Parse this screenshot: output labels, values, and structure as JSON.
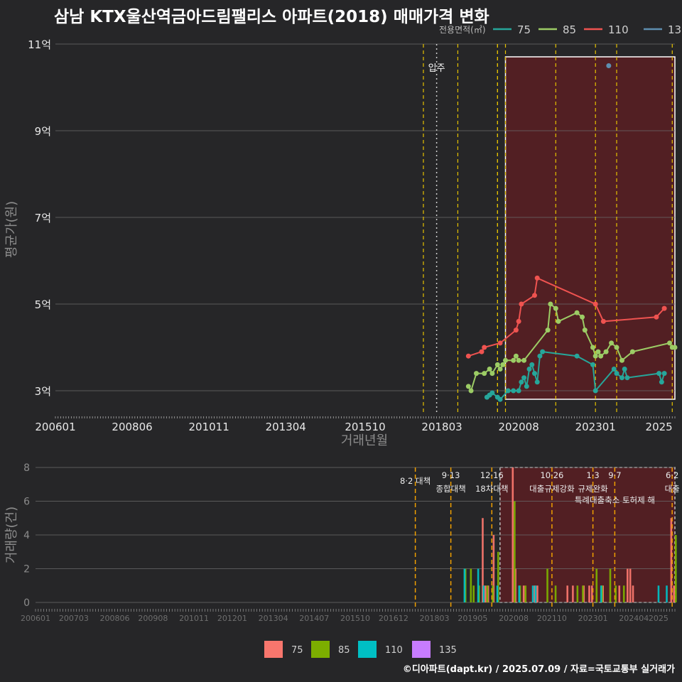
{
  "title": "삼남 KTX울산역금아드림팰리스 아파트(2018) 매매가격 변화",
  "credit": "©디아파트(dapt.kr) / 2025.07.09 / 자료=국토교통부 실거래가",
  "colors": {
    "75": "#f8766d",
    "85": "#7cae00",
    "110": "#00bfc4",
    "135": "#c77cff",
    "line75": "#26a69a",
    "line85": "#9ccc65",
    "line110": "#ef5350",
    "line135": "#5e8fb0",
    "policy": "#e6c200",
    "highlight": "#5a1e22"
  },
  "chart_data": [
    {
      "type": "line",
      "title": "삼남 KTX울산역금아드림팰리스 아파트(2018) 매매가격 변화",
      "xlabel": "거래년월",
      "ylabel": "평균가(원)",
      "x_ticks": [
        "200601",
        "200806",
        "201011",
        "201304",
        "201510",
        "201803",
        "202008",
        "202301",
        "2025"
      ],
      "y_ticks": [
        "3억",
        "5억",
        "7억",
        "9억",
        "11억"
      ],
      "ylim": [
        2.4,
        11.2
      ],
      "y_unit": "억",
      "legend_title": "전용면적(㎡)",
      "legend_position": "top-right",
      "move_in_label": "입주",
      "move_in_date": "2018-01",
      "highlight_range": [
        "2020-03",
        "2025-07"
      ],
      "series": [
        {
          "name": "75",
          "points": [
            [
              "2019-08",
              2.85
            ],
            [
              "2019-09",
              2.9
            ],
            [
              "2019-10",
              2.95
            ],
            [
              "2019-12",
              2.85
            ],
            [
              "2020-01",
              2.8
            ],
            [
              "2020-04",
              3.0
            ],
            [
              "2020-06",
              3.0
            ],
            [
              "2020-08",
              3.0
            ],
            [
              "2020-09",
              3.2
            ],
            [
              "2020-10",
              3.3
            ],
            [
              "2020-11",
              3.1
            ],
            [
              "2020-12",
              3.5
            ],
            [
              "2021-01",
              3.6
            ],
            [
              "2021-02",
              3.4
            ],
            [
              "2021-03",
              3.2
            ],
            [
              "2021-04",
              3.8
            ],
            [
              "2021-05",
              3.9
            ],
            [
              "2022-06",
              3.8
            ],
            [
              "2022-12",
              3.6
            ],
            [
              "2023-01",
              3.0
            ],
            [
              "2023-08",
              3.5
            ],
            [
              "2023-09",
              3.4
            ],
            [
              "2023-11",
              3.3
            ],
            [
              "2023-12",
              3.5
            ],
            [
              "2024-01",
              3.3
            ],
            [
              "2025-01",
              3.4
            ],
            [
              "2025-02",
              3.2
            ],
            [
              "2025-03",
              3.4
            ]
          ]
        },
        {
          "name": "85",
          "points": [
            [
              "2019-01",
              3.1
            ],
            [
              "2019-02",
              3.0
            ],
            [
              "2019-04",
              3.4
            ],
            [
              "2019-07",
              3.4
            ],
            [
              "2019-09",
              3.5
            ],
            [
              "2019-10",
              3.4
            ],
            [
              "2019-12",
              3.6
            ],
            [
              "2020-01",
              3.5
            ],
            [
              "2020-02",
              3.6
            ],
            [
              "2020-03",
              3.7
            ],
            [
              "2020-06",
              3.7
            ],
            [
              "2020-07",
              3.8
            ],
            [
              "2020-08",
              3.7
            ],
            [
              "2020-10",
              3.7
            ],
            [
              "2021-07",
              4.4
            ],
            [
              "2021-08",
              5.0
            ],
            [
              "2021-10",
              4.9
            ],
            [
              "2021-11",
              4.6
            ],
            [
              "2022-06",
              4.8
            ],
            [
              "2022-08",
              4.7
            ],
            [
              "2022-09",
              4.4
            ],
            [
              "2022-12",
              4.0
            ],
            [
              "2023-01",
              3.8
            ],
            [
              "2023-02",
              3.9
            ],
            [
              "2023-03",
              3.8
            ],
            [
              "2023-05",
              3.9
            ],
            [
              "2023-07",
              4.1
            ],
            [
              "2023-09",
              4.0
            ],
            [
              "2023-11",
              3.7
            ],
            [
              "2024-03",
              3.9
            ],
            [
              "2025-05",
              4.1
            ],
            [
              "2025-06",
              4.0
            ],
            [
              "2025-07",
              4.0
            ]
          ]
        },
        {
          "name": "110",
          "points": [
            [
              "2019-01",
              3.8
            ],
            [
              "2019-06",
              3.9
            ],
            [
              "2019-07",
              4.0
            ],
            [
              "2020-01",
              4.1
            ],
            [
              "2020-07",
              4.4
            ],
            [
              "2020-08",
              4.6
            ],
            [
              "2020-09",
              5.0
            ],
            [
              "2021-02",
              5.2
            ],
            [
              "2021-03",
              5.6
            ],
            [
              "2023-01",
              5.0
            ],
            [
              "2023-04",
              4.6
            ],
            [
              "2024-12",
              4.7
            ],
            [
              "2025-03",
              4.9
            ]
          ]
        },
        {
          "name": "135",
          "points": [
            [
              "2023-06",
              10.5
            ]
          ]
        }
      ]
    },
    {
      "type": "bar",
      "ylabel": "거래량(건)",
      "ylim": [
        0,
        8
      ],
      "y_ticks": [
        "0",
        "2",
        "4",
        "6",
        "8"
      ],
      "x_ticks": [
        "200601",
        "200703",
        "200806",
        "200908",
        "201011",
        "201201",
        "201304",
        "201407",
        "201510",
        "201612",
        "201803",
        "201905",
        "202008",
        "202110",
        "202301",
        "202404",
        "2025"
      ],
      "legend_position": "bottom",
      "legend": [
        "75",
        "85",
        "110",
        "135"
      ],
      "series": [
        {
          "name": "75",
          "points": [
            [
              "2019-09",
              5
            ],
            [
              "2019-10",
              1
            ],
            [
              "2019-11",
              1
            ],
            [
              "2020-01",
              4
            ],
            [
              "2020-08",
              8
            ],
            [
              "2020-09",
              2
            ],
            [
              "2020-12",
              1
            ],
            [
              "2021-04",
              1
            ],
            [
              "2021-05",
              1
            ],
            [
              "2022-04",
              1
            ],
            [
              "2022-06",
              1
            ],
            [
              "2022-10",
              1
            ],
            [
              "2022-12",
              1
            ],
            [
              "2023-01",
              1
            ],
            [
              "2023-05",
              1
            ],
            [
              "2023-11",
              1
            ],
            [
              "2024-02",
              2
            ],
            [
              "2024-03",
              2
            ],
            [
              "2024-04",
              1
            ],
            [
              "2025-06",
              5
            ],
            [
              "2025-07",
              1
            ]
          ]
        },
        {
          "name": "85",
          "points": [
            [
              "2019-02",
              2
            ],
            [
              "2019-04",
              2
            ],
            [
              "2019-05",
              1
            ],
            [
              "2019-07",
              1
            ],
            [
              "2019-10",
              1
            ],
            [
              "2019-12",
              1
            ],
            [
              "2020-02",
              3
            ],
            [
              "2020-08",
              6
            ],
            [
              "2020-10",
              1
            ],
            [
              "2020-12",
              1
            ],
            [
              "2021-08",
              2
            ],
            [
              "2021-11",
              1
            ],
            [
              "2022-07",
              1
            ],
            [
              "2022-09",
              1
            ],
            [
              "2023-02",
              2
            ],
            [
              "2023-04",
              1
            ],
            [
              "2023-07",
              2
            ],
            [
              "2023-09",
              1
            ],
            [
              "2023-12",
              1
            ],
            [
              "2025-07",
              4
            ]
          ]
        },
        {
          "name": "110",
          "points": [
            [
              "2019-01",
              2
            ],
            [
              "2019-06",
              2
            ],
            [
              "2019-08",
              1
            ],
            [
              "2020-01",
              1
            ],
            [
              "2020-09",
              1
            ],
            [
              "2021-02",
              1
            ],
            [
              "2021-03",
              1
            ],
            [
              "2023-03",
              1
            ],
            [
              "2024-12",
              1
            ],
            [
              "2025-03",
              1
            ]
          ]
        },
        {
          "name": "135",
          "points": []
        }
      ],
      "policies": [
        {
          "date": "2017-08",
          "label1": "8·2 대책",
          "label2": ""
        },
        {
          "date": "2018-09",
          "label1": "9·13",
          "label2": "종합대책"
        },
        {
          "date": "2019-12",
          "label1": "12·16",
          "label2": "18차대책"
        },
        {
          "date": "2021-10",
          "label1": "10·26",
          "label2": "대출규제강화"
        },
        {
          "date": "2023-01",
          "label1": "1·3",
          "label2": "규제완화"
        },
        {
          "date": "2023-09",
          "label1": "9·7",
          "label2": "특례대출축소 토허제 해"
        },
        {
          "date": "2025-06",
          "label1": "6·2",
          "label2": "대출"
        }
      ]
    }
  ]
}
